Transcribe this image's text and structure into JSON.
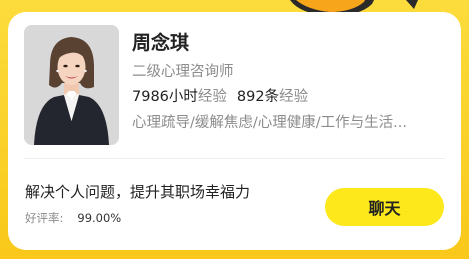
{
  "counselor": {
    "name": "周念琪",
    "title": "二级心理咨询师",
    "hours_value": "7986",
    "hours_unit": "小时",
    "hours_suffix": "经验",
    "reviews_value": "892",
    "reviews_unit": "条",
    "reviews_suffix": "经验",
    "specialties": "心理疏导/缓解焦虑/心理健康/工作与生活..."
  },
  "tagline": "解决个人问题，提升其职场幸福力",
  "rating": {
    "label": "好评率:",
    "value": "99.00%"
  },
  "chat_button_label": "聊天",
  "colors": {
    "background_yellow": "#fcdc3c",
    "button_yellow": "#fde81c",
    "text_primary": "#222222",
    "text_secondary": "#8c8c8c"
  }
}
